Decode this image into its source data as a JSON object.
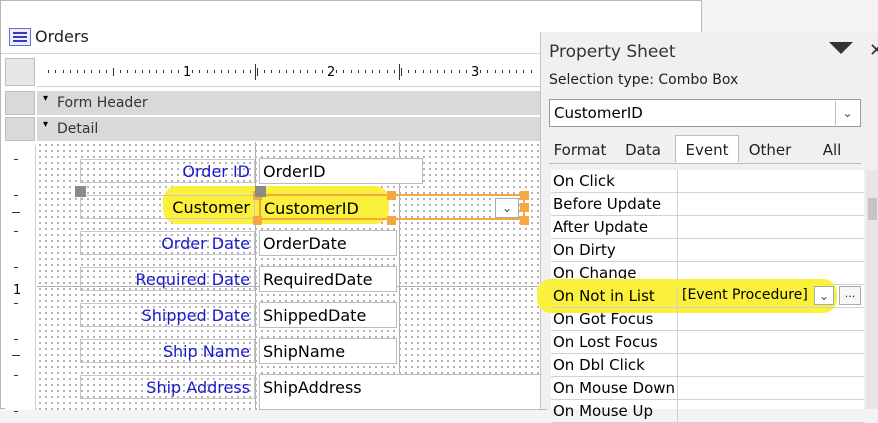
{
  "form": {
    "title": "Orders",
    "ruler_numbers": [
      "1",
      "2",
      "3"
    ],
    "left_ruler_number": "1",
    "sections": {
      "header": "Form Header",
      "detail": "Detail"
    },
    "fields": [
      {
        "label": "Order ID",
        "control": "OrderID"
      },
      {
        "label": "Customer",
        "control": "CustomerID",
        "combo": true,
        "selected": true
      },
      {
        "label": "Order Date",
        "control": "OrderDate"
      },
      {
        "label": "Required Date",
        "control": "RequiredDate"
      },
      {
        "label": "Shipped Date",
        "control": "ShippedDate"
      },
      {
        "label": "Ship Name",
        "control": "ShipName"
      },
      {
        "label": "Ship Address",
        "control": "ShipAddress"
      }
    ],
    "highlight_color": "#fbf03c",
    "label_color": "#1a1acc"
  },
  "property_sheet": {
    "title": "Property Sheet",
    "selection_type": "Selection type:  Combo Box",
    "object": "CustomerID",
    "tabs": [
      "Format",
      "Data",
      "Event",
      "Other",
      "All"
    ],
    "active_tab": "Event",
    "properties": [
      {
        "name": "On Click",
        "value": ""
      },
      {
        "name": "Before Update",
        "value": ""
      },
      {
        "name": "After Update",
        "value": ""
      },
      {
        "name": "On Dirty",
        "value": ""
      },
      {
        "name": "On Change",
        "value": ""
      },
      {
        "name": "On Not in List",
        "value": "[Event Procedure]",
        "highlighted": true
      },
      {
        "name": "On Got Focus",
        "value": ""
      },
      {
        "name": "On Lost Focus",
        "value": ""
      },
      {
        "name": "On Dbl Click",
        "value": ""
      },
      {
        "name": "On Mouse Down",
        "value": ""
      },
      {
        "name": "On Mouse Up",
        "value": ""
      }
    ],
    "builder_button": "..."
  }
}
